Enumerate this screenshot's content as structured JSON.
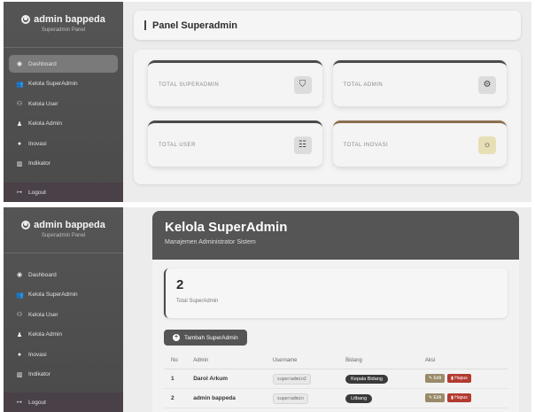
{
  "sidebar": {
    "brand_name": "admin bappeda",
    "brand_sub": "Superadmin Panel",
    "items": [
      {
        "label": "Dashboard",
        "icon": "dashboard-icon"
      },
      {
        "label": "Kelola SuperAdmin",
        "icon": "users-gear-icon"
      },
      {
        "label": "Kelola User",
        "icon": "users-icon"
      },
      {
        "label": "Kelola Admin",
        "icon": "user-tie-icon"
      },
      {
        "label": "Inovasi",
        "icon": "lightbulb-icon"
      },
      {
        "label": "Indikator",
        "icon": "chart-icon"
      }
    ],
    "logout_label": "Logout"
  },
  "dashboard": {
    "title": "Panel Superadmin",
    "stats": [
      {
        "label": "TOTAL SUPERADMIN",
        "icon": "shield-icon"
      },
      {
        "label": "TOTAL ADMIN",
        "icon": "user-cog-icon"
      },
      {
        "label": "TOTAL USER",
        "icon": "users-icon"
      },
      {
        "label": "TOTAL INOVASI",
        "icon": "lightbulb-icon"
      }
    ]
  },
  "kelola": {
    "title": "Kelola SuperAdmin",
    "subtitle": "Manajemen Administrator Sistem",
    "count_value": "2",
    "count_label": "Total SuperAdmin",
    "add_label": "Tambah SuperAdmin",
    "table": {
      "headers": [
        "No",
        "Admin",
        "Username",
        "Bidang",
        "Aksi"
      ],
      "rows": [
        {
          "no": "1",
          "admin": "Darol Arkum",
          "username": "superadmin2",
          "bidang": "Kepala Bidang"
        },
        {
          "no": "2",
          "admin": "admin bappeda",
          "username": "superadmin",
          "bidang": "Litbang"
        }
      ],
      "edit_label": "Edit",
      "delete_label": "Hapus"
    }
  },
  "colors": {
    "sidebar_bg": "#555555",
    "active_item": "#7a7a7a",
    "delete_button": "#b33a30",
    "edit_button": "#9a8a6a"
  }
}
